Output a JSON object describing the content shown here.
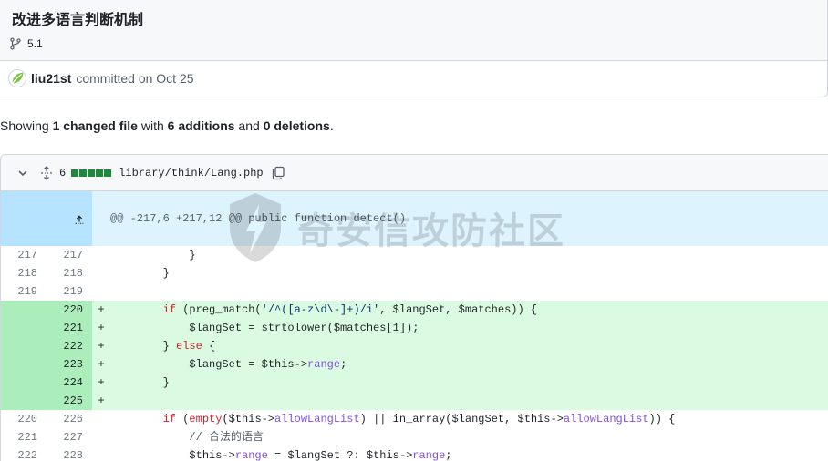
{
  "commit": {
    "title": "改进多语言判断机制",
    "branch": "5.1",
    "author": "liu21st",
    "committed_text": "committed on Oct 25"
  },
  "summary": {
    "prefix": "Showing ",
    "changed": "1 changed file",
    "with": " with ",
    "additions": "6 additions",
    "and": " and ",
    "deletions": "0 deletions",
    "suffix": "."
  },
  "file": {
    "change_count": "6",
    "path": "library/think/Lang.php",
    "hunk_header": "@@ -217,6 +217,12 @@ public function detect()"
  },
  "lines": [
    {
      "old": "217",
      "new": "217",
      "sign": "",
      "type": "ctx",
      "code": "            }"
    },
    {
      "old": "218",
      "new": "218",
      "sign": "",
      "type": "ctx",
      "code": "        }"
    },
    {
      "old": "219",
      "new": "219",
      "sign": "",
      "type": "ctx",
      "code": ""
    },
    {
      "old": "",
      "new": "220",
      "sign": "+",
      "type": "add",
      "code": "        if (preg_match('/^([a-z\\d\\-]+)/i', $langSet, $matches)) {"
    },
    {
      "old": "",
      "new": "221",
      "sign": "+",
      "type": "add",
      "code": "            $langSet = strtolower($matches[1]);"
    },
    {
      "old": "",
      "new": "222",
      "sign": "+",
      "type": "add",
      "code": "        } else {"
    },
    {
      "old": "",
      "new": "223",
      "sign": "+",
      "type": "add",
      "code": "            $langSet = $this->range;"
    },
    {
      "old": "",
      "new": "224",
      "sign": "+",
      "type": "add",
      "code": "        }"
    },
    {
      "old": "",
      "new": "225",
      "sign": "+",
      "type": "add",
      "code": ""
    },
    {
      "old": "220",
      "new": "226",
      "sign": "",
      "type": "ctx",
      "code": "        if (empty($this->allowLangList) || in_array($langSet, $this->allowLangList)) {"
    },
    {
      "old": "221",
      "new": "227",
      "sign": "",
      "type": "ctx",
      "code": "            // 合法的语言"
    },
    {
      "old": "222",
      "new": "228",
      "sign": "",
      "type": "ctx",
      "code": "            $this->range = $langSet ?: $this->range;"
    }
  ],
  "watermark": "奇安信攻防社区",
  "colors": {
    "add_num_bg": "#aceebb",
    "add_code_bg": "#dafbe1",
    "hunk_bg": "#ddf4ff",
    "hunk_expander_bg": "#b6e3ff",
    "diffstat_green": "#1f883d"
  },
  "icons": {
    "branch": "git-branch-icon",
    "avatar": "leaf-avatar",
    "collapse": "chevron-down-icon",
    "expand_all": "unfold-icon",
    "copy": "copy-icon",
    "expand_up": "expand-up-icon",
    "expand_down": "expand-down-icon"
  }
}
